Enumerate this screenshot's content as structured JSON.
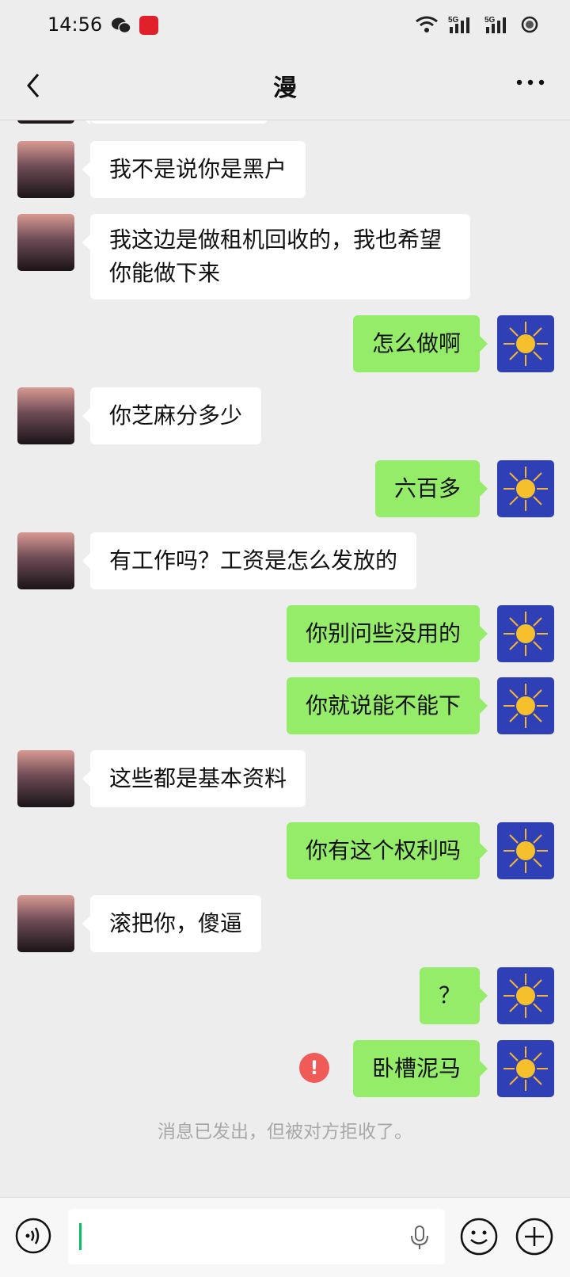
{
  "status_bar": {
    "time": "14:56",
    "net_label_1": "5G",
    "net_label_2": "5G"
  },
  "header": {
    "title": "漫"
  },
  "messages": [
    {
      "side": "left",
      "text": "我不是说你是黑户"
    },
    {
      "side": "left",
      "text": "我这边是做租机回收的，我也希望你能做下来"
    },
    {
      "side": "right",
      "text": "怎么做啊"
    },
    {
      "side": "left",
      "text": "你芝麻分多少"
    },
    {
      "side": "right",
      "text": "六百多"
    },
    {
      "side": "left",
      "text": "有工作吗？工资是怎么发放的"
    },
    {
      "side": "right",
      "text": "你别问些没用的"
    },
    {
      "side": "right",
      "text": "你就说能不能下"
    },
    {
      "side": "left",
      "text": "这些都是基本资料"
    },
    {
      "side": "right",
      "text": "你有这个权利吗"
    },
    {
      "side": "left",
      "text": "滚把你，傻逼"
    },
    {
      "side": "right",
      "text": "？"
    },
    {
      "side": "right",
      "text": "卧槽泥马",
      "failed": true,
      "fail_mark": "!"
    }
  ],
  "system_note": "消息已发出，但被对方拒收了。",
  "colors": {
    "own_bubble": "#95ec69",
    "peer_bubble": "#ffffff",
    "background": "#ededed",
    "error": "#f05a57",
    "caret": "#07c160"
  },
  "icons": [
    "back-arrow-icon",
    "more-dots-icon",
    "wifi-icon",
    "signal-icon",
    "battery-icon",
    "voice-icon",
    "mic-icon",
    "emoji-icon",
    "plus-icon"
  ]
}
